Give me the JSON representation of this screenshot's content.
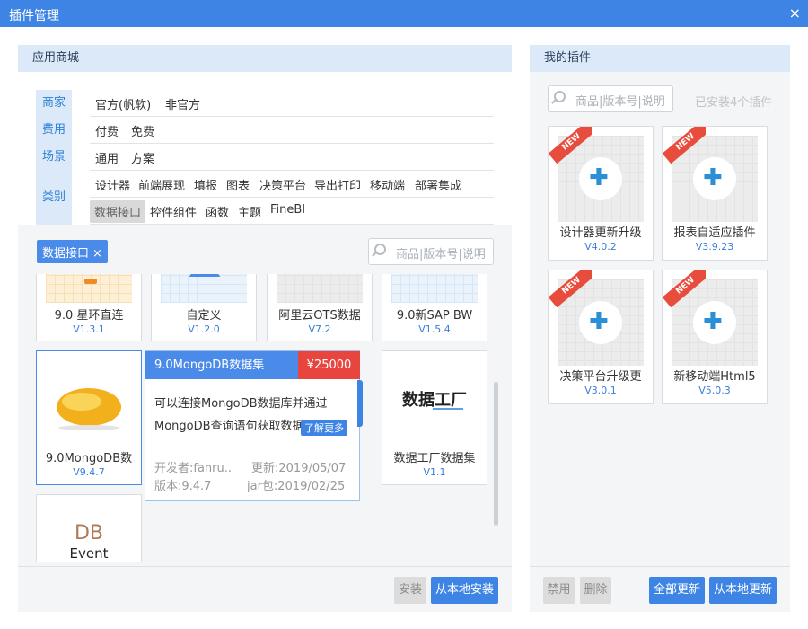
{
  "window": {
    "title": "插件管理",
    "close_icon": "×"
  },
  "store": {
    "title": "应用商城",
    "categories": [
      "商家",
      "费用",
      "场景",
      "类别"
    ],
    "filters": {
      "merchant": [
        "官方(帆软)",
        "非官方"
      ],
      "cost": [
        "付费",
        "免费"
      ],
      "scene": [
        "通用",
        "方案"
      ],
      "type_row1": [
        "设计器",
        "前端展现",
        "填报",
        "图表",
        "决策平台",
        "导出打印",
        "移动端",
        "部署集成"
      ],
      "type_row2": [
        "数据接口",
        "控件组件",
        "函数",
        "主题",
        "FineBI"
      ],
      "selected": "数据接口"
    },
    "active_tag": "数据接口",
    "tag_remove_icon": "×",
    "search_placeholder": "商品|版本号|说明",
    "plugins": [
      {
        "name": "9.0 星环直连",
        "version": "V1.3.1"
      },
      {
        "name": "自定义",
        "version": "V1.2.0"
      },
      {
        "name": "阿里云OTS数据",
        "version": "V7.2"
      },
      {
        "name": "9.0新SAP BW",
        "version": "V1.5.4"
      },
      {
        "name": "9.0MongoDB数",
        "version": "V9.4.7"
      },
      {
        "name": "数据工厂数据集",
        "version": "V1.1"
      },
      {
        "name": "",
        "version": ""
      }
    ],
    "data_factory_logo": "数据工厂",
    "db_event_logo": {
      "line1": "DB",
      "line2": "Event"
    },
    "popup": {
      "title": "9.0MongoDB数据集",
      "price": "¥25000",
      "desc_line1": "可以连接MongoDB数据库并通过",
      "desc_line2": "MongoDB查询语句获取数据",
      "more": "了解更多",
      "developer": "开发者:fanru..",
      "updated": "更新:2019/05/07",
      "version": "版本:9.4.7",
      "jar": "jar包:2019/02/25"
    },
    "buttons": {
      "install": "安装",
      "install_local": "从本地安装"
    }
  },
  "mine": {
    "title": "我的插件",
    "search_placeholder": "商品|版本号|说明",
    "installed_count": "已安装4个插件",
    "new_badge": "NEW",
    "plugins": [
      {
        "name": "设计器更新升级",
        "version": "V4.0.2"
      },
      {
        "name": "报表自适应插件",
        "version": "V3.9.23"
      },
      {
        "name": "决策平台升级更",
        "version": "V3.0.1"
      },
      {
        "name": "新移动端Html5",
        "version": "V5.0.3"
      }
    ],
    "buttons": {
      "disable": "禁用",
      "delete": "删除",
      "update_all": "全部更新",
      "update_local": "从本地更新"
    }
  },
  "icons": {
    "puzzle": "puzzle-icon",
    "search": "search-icon",
    "close": "close-icon"
  }
}
